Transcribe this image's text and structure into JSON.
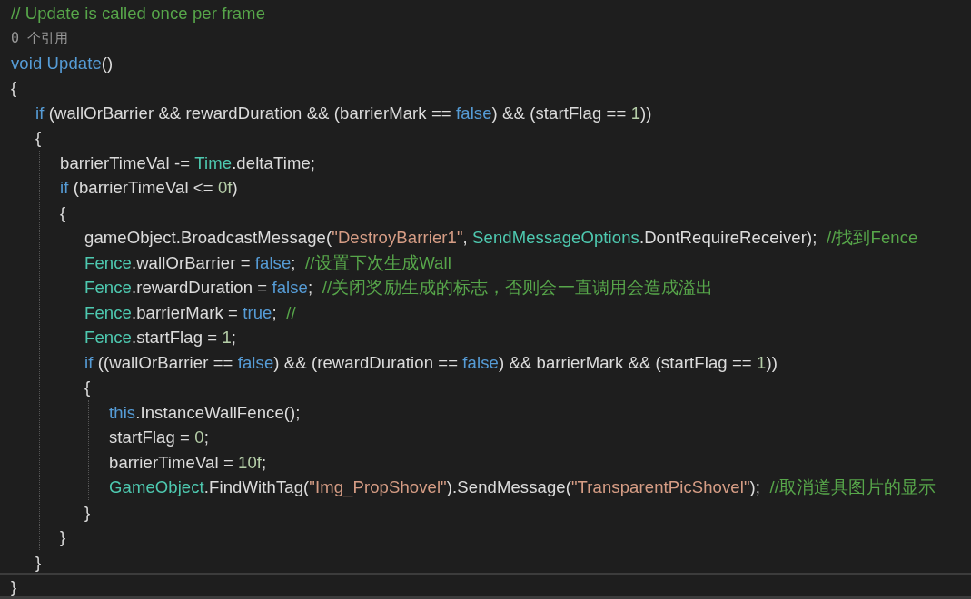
{
  "editor": {
    "lines": [
      {
        "tokens": [
          {
            "kind": "comment",
            "text": "// Update is called once per frame"
          }
        ]
      },
      {
        "tokens": [
          {
            "kind": "codelens",
            "text": "0 个引用"
          }
        ]
      },
      {
        "tokens": [
          {
            "kind": "keyword",
            "text": "void "
          },
          {
            "kind": "method",
            "text": "Update"
          },
          {
            "kind": "plain",
            "text": "()"
          }
        ]
      },
      {
        "tokens": [
          {
            "kind": "plain",
            "text": "{"
          }
        ],
        "children": [
          {
            "tokens": [
              {
                "kind": "keyword",
                "text": "if"
              },
              {
                "kind": "plain",
                "text": " (wallOrBarrier && rewardDuration && (barrierMark == "
              },
              {
                "kind": "keyword",
                "text": "false"
              },
              {
                "kind": "plain",
                "text": ") && (startFlag == "
              },
              {
                "kind": "number",
                "text": "1"
              },
              {
                "kind": "plain",
                "text": "))"
              }
            ]
          },
          {
            "tokens": [
              {
                "kind": "plain",
                "text": "{"
              }
            ],
            "children": [
              {
                "tokens": [
                  {
                    "kind": "plain",
                    "text": "barrierTimeVal -= "
                  },
                  {
                    "kind": "type",
                    "text": "Time"
                  },
                  {
                    "kind": "plain",
                    "text": ".deltaTime;"
                  }
                ]
              },
              {
                "tokens": [
                  {
                    "kind": "keyword",
                    "text": "if"
                  },
                  {
                    "kind": "plain",
                    "text": " (barrierTimeVal <= "
                  },
                  {
                    "kind": "number",
                    "text": "0f"
                  },
                  {
                    "kind": "plain",
                    "text": ")"
                  }
                ]
              },
              {
                "tokens": [
                  {
                    "kind": "plain",
                    "text": "{"
                  }
                ],
                "children": [
                  {
                    "tokens": [
                      {
                        "kind": "plain",
                        "text": "gameObject.BroadcastMessage("
                      },
                      {
                        "kind": "string",
                        "text": "\"DestroyBarrier1\""
                      },
                      {
                        "kind": "plain",
                        "text": ", "
                      },
                      {
                        "kind": "type",
                        "text": "SendMessageOptions"
                      },
                      {
                        "kind": "plain",
                        "text": ".DontRequireReceiver);  "
                      },
                      {
                        "kind": "comment",
                        "text": "//找到Fence"
                      }
                    ]
                  },
                  {
                    "tokens": [
                      {
                        "kind": "type",
                        "text": "Fence"
                      },
                      {
                        "kind": "plain",
                        "text": ".wallOrBarrier = "
                      },
                      {
                        "kind": "keyword",
                        "text": "false"
                      },
                      {
                        "kind": "plain",
                        "text": ";  "
                      },
                      {
                        "kind": "comment",
                        "text": "//设置下次生成Wall"
                      }
                    ]
                  },
                  {
                    "tokens": [
                      {
                        "kind": "type",
                        "text": "Fence"
                      },
                      {
                        "kind": "plain",
                        "text": ".rewardDuration = "
                      },
                      {
                        "kind": "keyword",
                        "text": "false"
                      },
                      {
                        "kind": "plain",
                        "text": ";  "
                      },
                      {
                        "kind": "comment",
                        "text": "//关闭奖励生成的标志，否则会一直调用会造成溢出"
                      }
                    ]
                  },
                  {
                    "tokens": [
                      {
                        "kind": "type",
                        "text": "Fence"
                      },
                      {
                        "kind": "plain",
                        "text": ".barrierMark = "
                      },
                      {
                        "kind": "keyword",
                        "text": "true"
                      },
                      {
                        "kind": "plain",
                        "text": ";  "
                      },
                      {
                        "kind": "comment",
                        "text": "//"
                      }
                    ]
                  },
                  {
                    "tokens": [
                      {
                        "kind": "type",
                        "text": "Fence"
                      },
                      {
                        "kind": "plain",
                        "text": ".startFlag = "
                      },
                      {
                        "kind": "number",
                        "text": "1"
                      },
                      {
                        "kind": "plain",
                        "text": ";"
                      }
                    ]
                  },
                  {
                    "tokens": [
                      {
                        "kind": "keyword",
                        "text": "if"
                      },
                      {
                        "kind": "plain",
                        "text": " ((wallOrBarrier == "
                      },
                      {
                        "kind": "keyword",
                        "text": "false"
                      },
                      {
                        "kind": "plain",
                        "text": ") && (rewardDuration == "
                      },
                      {
                        "kind": "keyword",
                        "text": "false"
                      },
                      {
                        "kind": "plain",
                        "text": ") && barrierMark && (startFlag == "
                      },
                      {
                        "kind": "number",
                        "text": "1"
                      },
                      {
                        "kind": "plain",
                        "text": "))"
                      }
                    ]
                  },
                  {
                    "tokens": [
                      {
                        "kind": "plain",
                        "text": "{"
                      }
                    ],
                    "children": [
                      {
                        "tokens": [
                          {
                            "kind": "keyword",
                            "text": "this"
                          },
                          {
                            "kind": "plain",
                            "text": ".InstanceWallFence();"
                          }
                        ]
                      },
                      {
                        "tokens": [
                          {
                            "kind": "plain",
                            "text": "startFlag = "
                          },
                          {
                            "kind": "number",
                            "text": "0"
                          },
                          {
                            "kind": "plain",
                            "text": ";"
                          }
                        ]
                      },
                      {
                        "tokens": [
                          {
                            "kind": "plain",
                            "text": "barrierTimeVal = "
                          },
                          {
                            "kind": "number",
                            "text": "10f"
                          },
                          {
                            "kind": "plain",
                            "text": ";"
                          }
                        ]
                      },
                      {
                        "tokens": [
                          {
                            "kind": "type",
                            "text": "GameObject"
                          },
                          {
                            "kind": "plain",
                            "text": ".FindWithTag("
                          },
                          {
                            "kind": "string",
                            "text": "\"Img_PropShovel\""
                          },
                          {
                            "kind": "plain",
                            "text": ").SendMessage("
                          },
                          {
                            "kind": "string",
                            "text": "\"TransparentPicShovel\""
                          },
                          {
                            "kind": "plain",
                            "text": ");  "
                          },
                          {
                            "kind": "comment",
                            "text": "//取消道具图片的显示"
                          }
                        ]
                      }
                    ]
                  },
                  {
                    "tokens": [
                      {
                        "kind": "plain",
                        "text": "}"
                      }
                    ]
                  }
                ]
              },
              {
                "tokens": [
                  {
                    "kind": "plain",
                    "text": "}"
                  }
                ]
              }
            ]
          },
          {
            "tokens": [
              {
                "kind": "plain",
                "text": "}"
              }
            ]
          }
        ]
      },
      {
        "tokens": [
          {
            "kind": "plain",
            "text": "}"
          }
        ]
      }
    ]
  }
}
